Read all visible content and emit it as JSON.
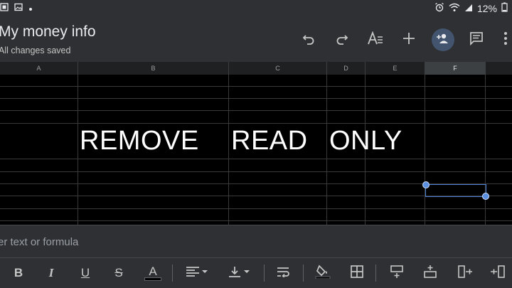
{
  "status": {
    "battery": "12%"
  },
  "doc": {
    "title": "My money info",
    "save_status": "All changes saved"
  },
  "columns": [
    "A",
    "B",
    "C",
    "D",
    "E",
    "F"
  ],
  "overlay": {
    "word1": "REMOVE",
    "word2": "READ",
    "word3": "ONLY"
  },
  "formula": {
    "placeholder": "er text or formula"
  },
  "format_toolbar": {
    "bold": "B",
    "italic": "I",
    "underline": "U",
    "strike": "S",
    "text_color": "A"
  },
  "colors": {
    "accent": "#4a7fd6",
    "share_bg": "#42546e",
    "bar": "#2f3033"
  }
}
